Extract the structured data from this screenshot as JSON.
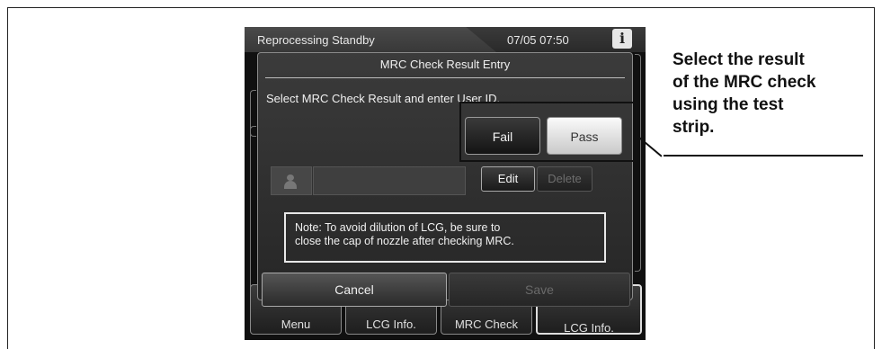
{
  "screen": {
    "status": "Reprocessing Standby",
    "datetime": "07/05 07:50",
    "info_glyph": "i"
  },
  "background_nav": {
    "items": [
      "Menu",
      "LCG Info.",
      "MRC Check",
      "LCG Info."
    ]
  },
  "dialog": {
    "title": "MRC Check Result Entry",
    "instruction": "Select MRC Check Result and enter User ID.",
    "fail_label": "Fail",
    "pass_label": "Pass",
    "user_id_value": "",
    "edit_label": "Edit",
    "delete_label": "Delete",
    "note_line1": "Note: To avoid dilution of LCG, be sure to",
    "note_line2": "close the cap of nozzle after checking MRC.",
    "cancel_label": "Cancel",
    "save_label": "Save"
  },
  "callout": {
    "lines": [
      "Select the result",
      "of the MRC check",
      "using the test",
      "strip."
    ]
  },
  "icons": {
    "info": "info-icon",
    "user": "user-icon"
  }
}
